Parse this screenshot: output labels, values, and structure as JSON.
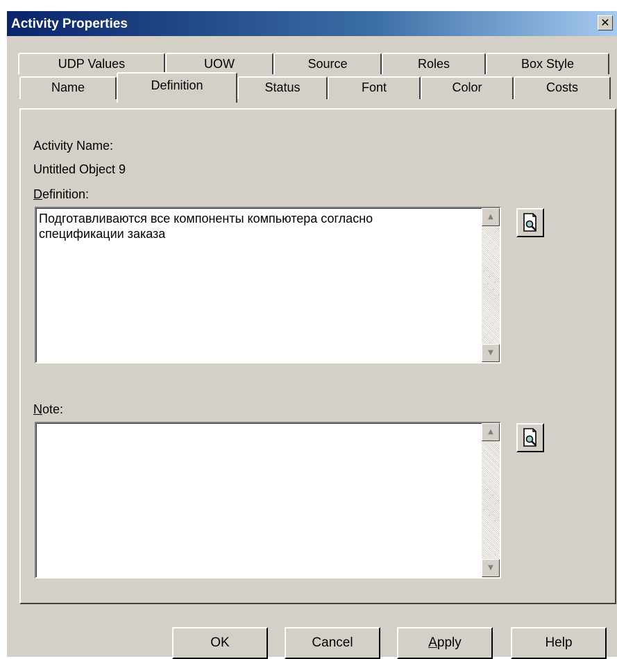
{
  "window": {
    "title": "Activity Properties",
    "close_glyph": "✕"
  },
  "tabs_row1": [
    "UDP Values",
    "UOW",
    "Source",
    "Roles",
    "Box Style"
  ],
  "tabs_row2": [
    "Name",
    "Definition",
    "Status",
    "Font",
    "Color",
    "Costs"
  ],
  "active_tab": "Definition",
  "panel": {
    "activity_name_label": "Activity Name:",
    "activity_name_value": "Untitled Object 9",
    "definition_label_mnemonic": "D",
    "definition_label_rest": "efinition:",
    "definition_text": "Подготавливаются все компоненты компьютера согласно\nспецификации заказа",
    "note_label_mnemonic": "N",
    "note_label_rest": "ote:",
    "note_text": "",
    "zoom_icon": "document-zoom-icon"
  },
  "buttons": {
    "ok": "OK",
    "cancel": "Cancel",
    "apply_mnemonic": "A",
    "apply_rest": "pply",
    "help": "Help"
  },
  "colors": {
    "face": "#d4d0c8",
    "title_start": "#0a246a",
    "title_end": "#a6caf0"
  }
}
